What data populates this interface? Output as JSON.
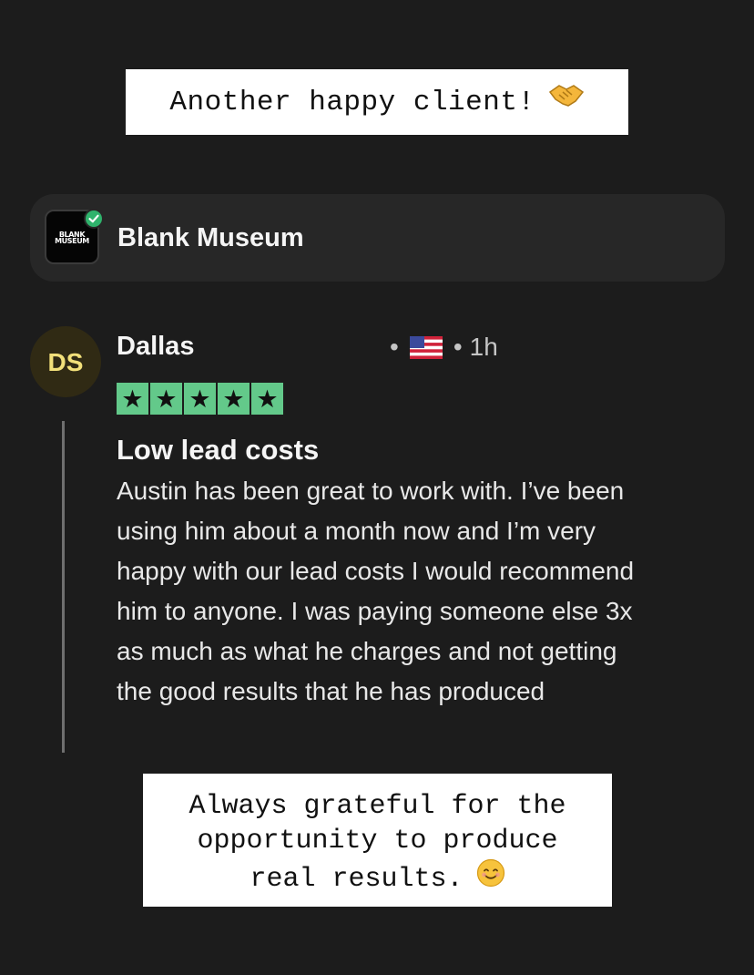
{
  "captions": {
    "top": "Another happy client!",
    "bottom_lines": [
      "Always grateful for the",
      "opportunity to produce",
      "real results."
    ]
  },
  "icons": {
    "handshake": "handshake-emoji",
    "smile": "smiling-face-emoji",
    "flag": "us-flag-emoji",
    "verified": "verified-check-badge"
  },
  "business": {
    "logo_text": "BLANK MUSEUM",
    "name": "Blank Museum"
  },
  "review": {
    "avatar_initials": "DS",
    "reviewer_name": "Dallas",
    "time": "1h",
    "rating": 5,
    "title": "Low lead costs",
    "body_lines": [
      "Austin has been great to work with. I’ve been",
      "using him about a month now and I’m very",
      "happy with our lead costs I would recommend",
      "him to anyone. I was paying someone else 3x",
      "as much as what he charges and not getting",
      "the good results that he has produced"
    ]
  },
  "colors": {
    "background": "#1c1c1c",
    "card": "#272727",
    "star_green": "#63c98a",
    "verified_green": "#2fb36c",
    "avatar_bg": "#302a14",
    "avatar_text": "#f2e07a"
  }
}
